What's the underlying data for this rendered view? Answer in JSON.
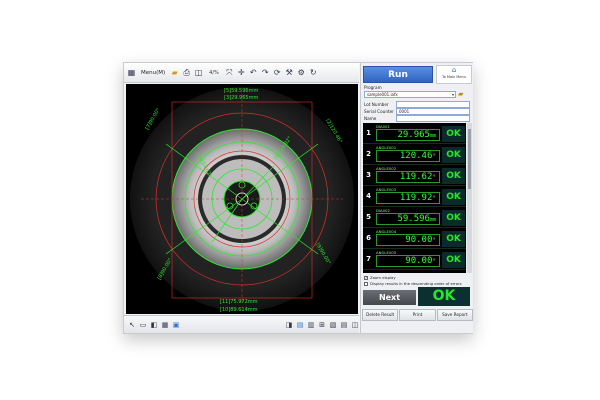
{
  "toolbar": {
    "menu_label": "Menu(M)",
    "zoom_label": "4/%",
    "icons": [
      "layout-icon",
      "menu-icon",
      "folder-icon",
      "print-icon",
      "zoom-icon",
      "fit-icon",
      "undo-icon",
      "redo-icon",
      "rotate-icon",
      "tool-icon",
      "settings-icon",
      "refresh-icon"
    ]
  },
  "viewer": {
    "dim_top_1": "[5]59.596mm",
    "dim_top_2": "[3]29.965mm",
    "dim_bottom_1": "[11]75.972mm",
    "dim_bottom_2": "[10]89.614mm",
    "angle_tl": "[7]90.00°",
    "angle_tr": "[2]120.46°",
    "angle_bl": "[8]90.00°",
    "angle_br": "[9]90.00°",
    "angle_m1": "[4]119.62°",
    "angle_m2": "[6]119.92°"
  },
  "right": {
    "run_label": "Run",
    "main_menu_label": "To Main Menu",
    "program_label": "Program",
    "program_value": "sample001.iafx",
    "lot_label": "Lot Number",
    "serial_label": "Serial Counter",
    "serial_value": "0001",
    "name_label": "Name",
    "results": [
      {
        "num": "1",
        "name": "DIA001",
        "value": "29.965",
        "unit": "mm",
        "status": "OK"
      },
      {
        "num": "2",
        "name": "ANGLE001",
        "value": "120.46",
        "unit": "°",
        "status": "OK"
      },
      {
        "num": "3",
        "name": "ANGLE002",
        "value": "119.62",
        "unit": "°",
        "status": "OK"
      },
      {
        "num": "4",
        "name": "ANGLE003",
        "value": "119.92",
        "unit": "°",
        "status": "OK"
      },
      {
        "num": "5",
        "name": "DIA002",
        "value": "59.596",
        "unit": "mm",
        "status": "OK"
      },
      {
        "num": "6",
        "name": "ANGLE004",
        "value": "90.00",
        "unit": "°",
        "status": "OK"
      },
      {
        "num": "7",
        "name": "ANGLE005",
        "value": "90.00",
        "unit": "°",
        "status": "OK"
      }
    ],
    "zoom_display_label": "Zoom display",
    "desc_order_label": "Display results in the descending order of errors",
    "next_label": "Next",
    "overall_status": "OK",
    "delete_result_label": "Delete Result",
    "print_label": "Print",
    "save_report_label": "Save Report"
  }
}
